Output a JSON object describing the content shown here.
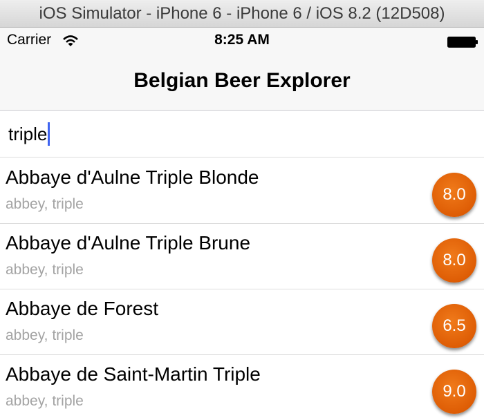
{
  "simulator": {
    "title": "iOS Simulator - iPhone 6 - iPhone 6 / iOS 8.2 (12D508)"
  },
  "status_bar": {
    "carrier": "Carrier",
    "time": "8:25 AM",
    "icons": [
      "wifi-icon",
      "battery-icon"
    ]
  },
  "nav": {
    "title": "Belgian Beer Explorer"
  },
  "search": {
    "value": "triple"
  },
  "beers": [
    {
      "name": "Abbaye d'Aulne Triple Blonde",
      "tags": "abbey, triple",
      "abv": "8.0"
    },
    {
      "name": "Abbaye d'Aulne Triple Brune",
      "tags": "abbey, triple",
      "abv": "8.0"
    },
    {
      "name": "Abbaye de Forest",
      "tags": "abbey, triple",
      "abv": "6.5"
    },
    {
      "name": "Abbaye de Saint-Martin Triple",
      "tags": "abbey, triple",
      "abv": "9.0"
    }
  ],
  "colors": {
    "badge": "#de5d05",
    "caret": "#3f64f0",
    "subtitle": "#a3a3a3"
  }
}
